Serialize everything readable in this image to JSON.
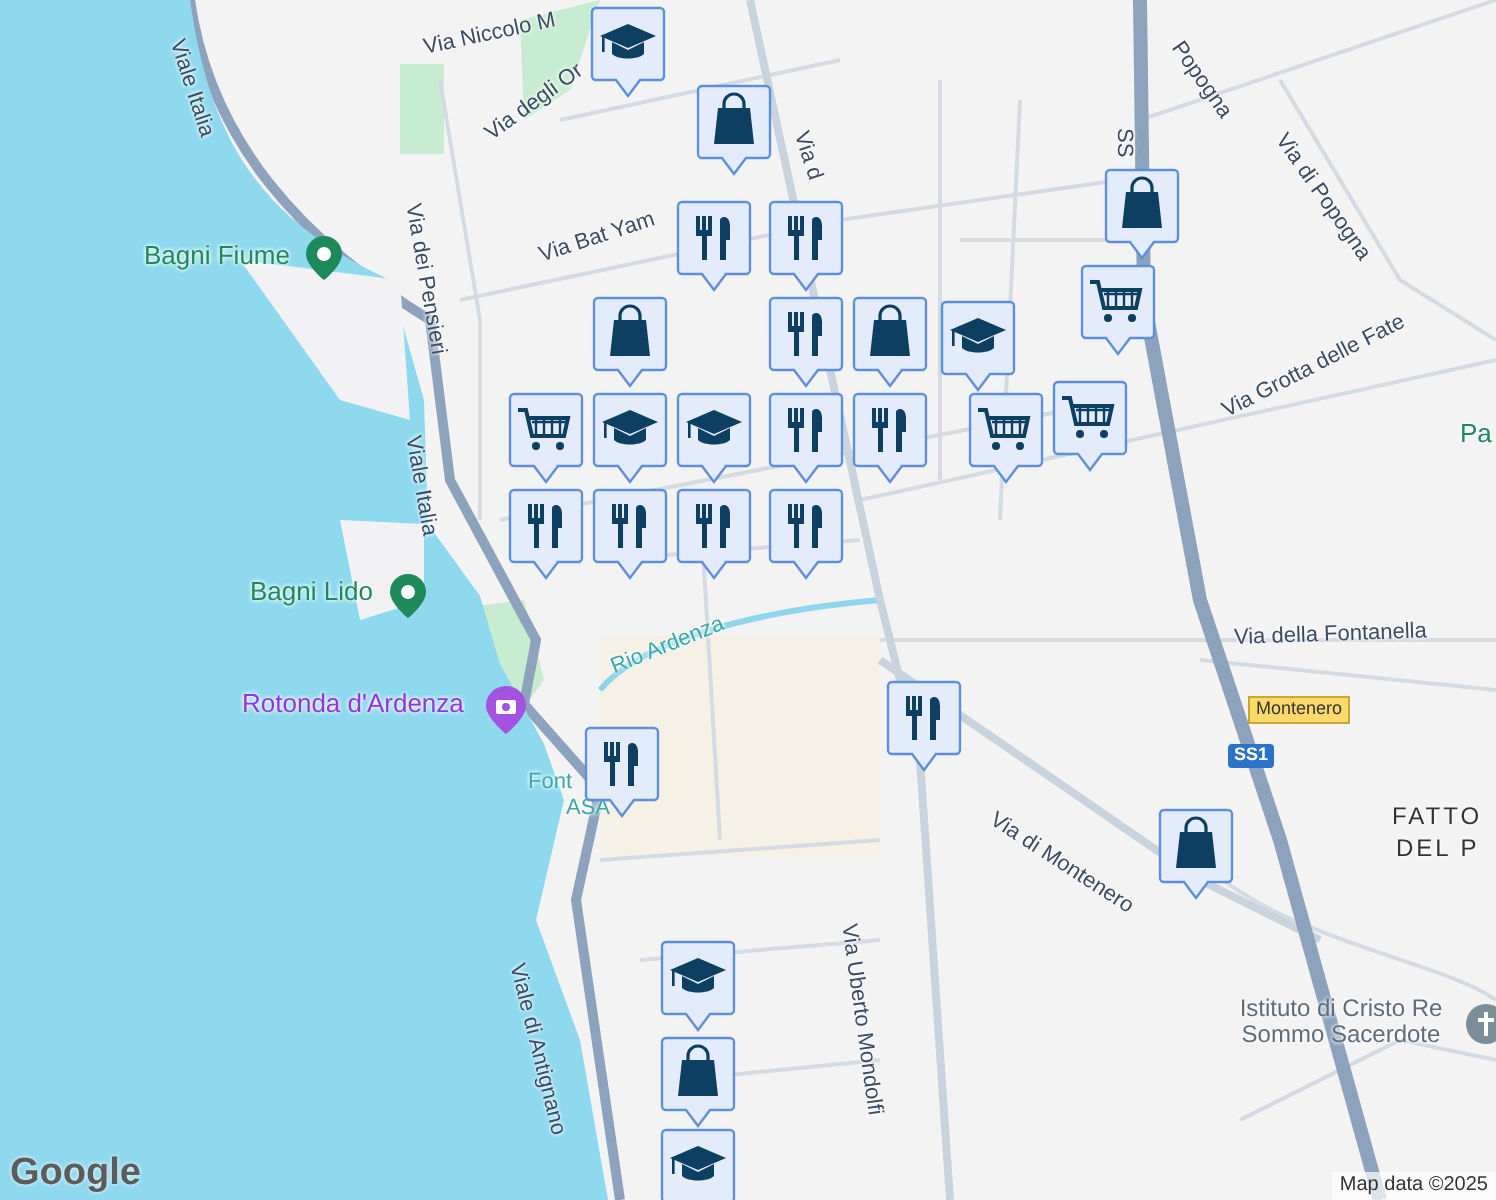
{
  "map": {
    "labels": [
      {
        "kind": "street",
        "text": "Via Niccolo M"
      },
      {
        "kind": "street",
        "text": "Viale Italia"
      },
      {
        "kind": "street",
        "text": "Via degli Or"
      },
      {
        "kind": "street",
        "text": "Via dei Pensieri"
      },
      {
        "kind": "street",
        "text": "Via Bat Yam"
      },
      {
        "kind": "street",
        "text": "Via d"
      },
      {
        "kind": "park",
        "text": "Bagni Fiume"
      },
      {
        "kind": "street",
        "text": "Viale Italia"
      },
      {
        "kind": "park",
        "text": "Bagni Lido"
      },
      {
        "kind": "attraction",
        "text": "Rotonda d'Ardenza"
      },
      {
        "kind": "water",
        "text": "Rio Ardenza"
      },
      {
        "kind": "water",
        "text": "Font"
      },
      {
        "kind": "water",
        "text": "ASA"
      },
      {
        "kind": "street",
        "text": "Viale di Antignano"
      },
      {
        "kind": "street",
        "text": "Via Uberto Mondolfi"
      },
      {
        "kind": "street",
        "text": "Via di Montenero"
      },
      {
        "kind": "street",
        "text": "Popogna"
      },
      {
        "kind": "street",
        "text": "Via di Popogna"
      },
      {
        "kind": "street",
        "text": "SS"
      },
      {
        "kind": "street",
        "text": "Via Grotta delle Fate"
      },
      {
        "kind": "park",
        "text": "Pa"
      },
      {
        "kind": "street",
        "text": "Via della Fontanella"
      },
      {
        "kind": "badge",
        "text": "Montenero"
      },
      {
        "kind": "shield",
        "text": "SS1"
      },
      {
        "kind": "area",
        "text": "FATTO"
      },
      {
        "kind": "area",
        "text": "DEL P"
      },
      {
        "kind": "institution",
        "text": "Istituto di Cristo Re Sommo Sacerdote"
      }
    ],
    "markers": [
      {
        "kind": "school"
      },
      {
        "kind": "shop"
      },
      {
        "kind": "shop"
      },
      {
        "kind": "restaurant"
      },
      {
        "kind": "restaurant"
      },
      {
        "kind": "grocery"
      },
      {
        "kind": "shop"
      },
      {
        "kind": "restaurant"
      },
      {
        "kind": "shop"
      },
      {
        "kind": "school"
      },
      {
        "kind": "grocery"
      },
      {
        "kind": "school"
      },
      {
        "kind": "school"
      },
      {
        "kind": "restaurant"
      },
      {
        "kind": "restaurant"
      },
      {
        "kind": "grocery"
      },
      {
        "kind": "grocery"
      },
      {
        "kind": "restaurant"
      },
      {
        "kind": "restaurant"
      },
      {
        "kind": "restaurant"
      },
      {
        "kind": "restaurant"
      },
      {
        "kind": "restaurant"
      },
      {
        "kind": "restaurant"
      },
      {
        "kind": "shop"
      },
      {
        "kind": "school"
      },
      {
        "kind": "shop"
      },
      {
        "kind": "school"
      }
    ],
    "attribution": "Map data ©2025",
    "logo": "Google"
  }
}
